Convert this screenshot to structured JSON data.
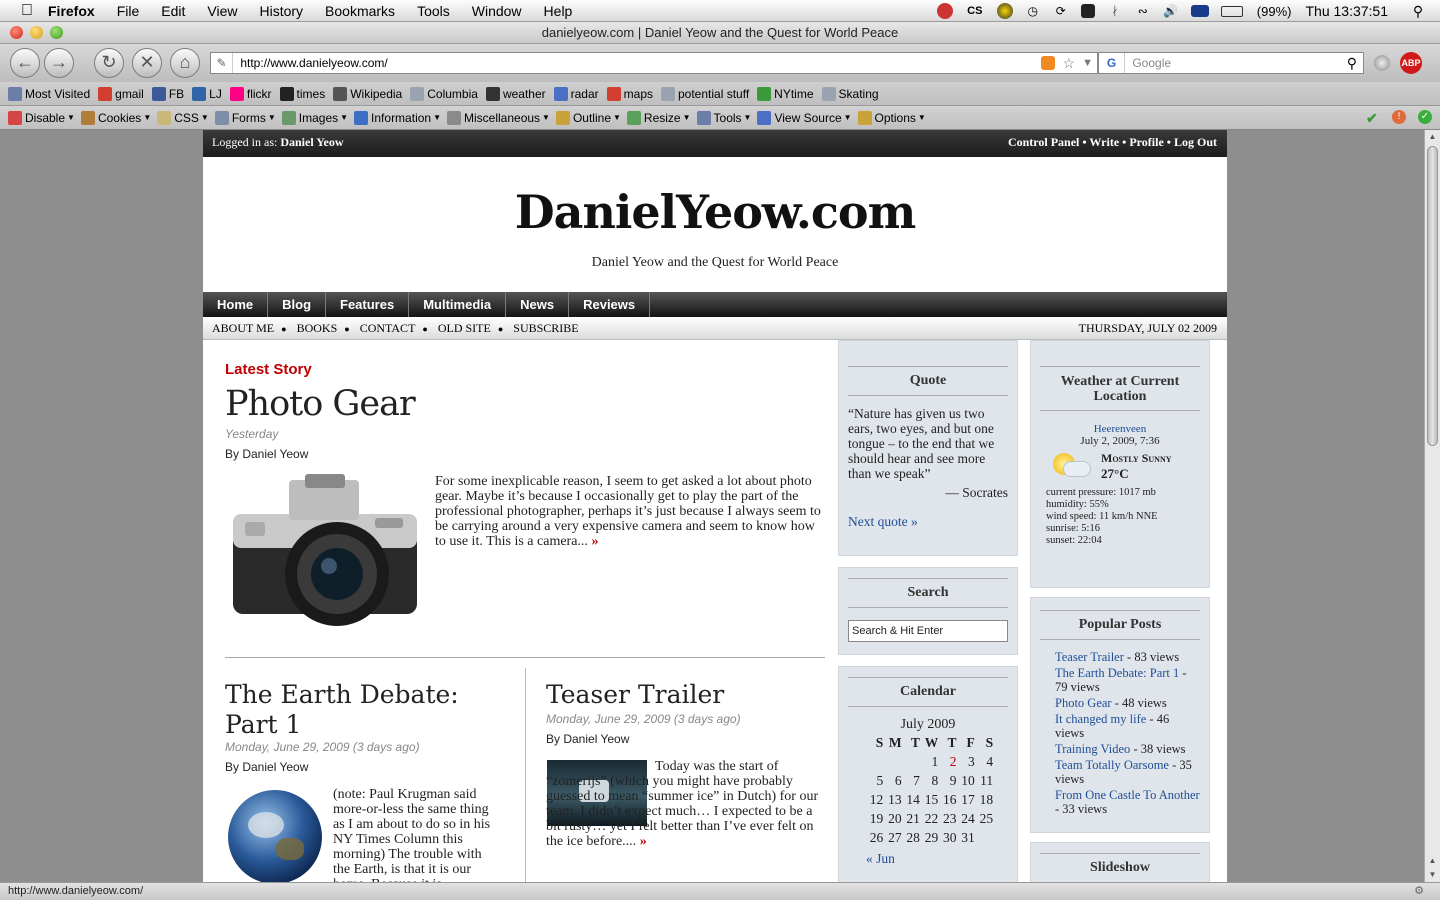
{
  "menubar": {
    "app": "Firefox",
    "items": [
      "File",
      "Edit",
      "View",
      "History",
      "Bookmarks",
      "Tools",
      "Window",
      "Help"
    ],
    "battery": "(99%)",
    "clock": "Thu 13:37:51"
  },
  "window": {
    "title": "danielyeow.com | Daniel Yeow and the Quest for World Peace"
  },
  "navbar": {
    "url": "http://www.danielyeow.com/",
    "search_placeholder": "Google"
  },
  "bookmarks": [
    {
      "label": "Most Visited",
      "icon": "bookmark-icon",
      "color": "#6a7ea8"
    },
    {
      "label": "gmail",
      "icon": "google-icon",
      "color": "#d23f31"
    },
    {
      "label": "FB",
      "icon": "facebook-icon",
      "color": "#3b5998"
    },
    {
      "label": "LJ",
      "icon": "livejournal-icon",
      "color": "#3066a8"
    },
    {
      "label": "flickr",
      "icon": "flickr-icon",
      "color": "#ff0084"
    },
    {
      "label": "times",
      "icon": "times-icon",
      "color": "#222222"
    },
    {
      "label": "Wikipedia",
      "icon": "wikipedia-icon",
      "color": "#555555"
    },
    {
      "label": "Columbia",
      "icon": "folder-icon",
      "color": "#9aa4b0"
    },
    {
      "label": "weather",
      "icon": "bbc-icon",
      "color": "#333333"
    },
    {
      "label": "radar",
      "icon": "radar-icon",
      "color": "#4a6fc4"
    },
    {
      "label": "maps",
      "icon": "google-icon",
      "color": "#d23f31"
    },
    {
      "label": "potential stuff",
      "icon": "folder-icon",
      "color": "#9aa4b0"
    },
    {
      "label": "NYtime",
      "icon": "nytimes-icon",
      "color": "#3a9a3a"
    },
    {
      "label": "Skating",
      "icon": "folder-icon",
      "color": "#9aa4b0"
    }
  ],
  "webdev": [
    {
      "label": "Disable",
      "icon": "disable-icon",
      "color": "#d64545"
    },
    {
      "label": "Cookies",
      "icon": "cookie-icon",
      "color": "#b07d3a"
    },
    {
      "label": "CSS",
      "icon": "css-icon",
      "color": "#c9b878"
    },
    {
      "label": "Forms",
      "icon": "forms-icon",
      "color": "#7d8fa8"
    },
    {
      "label": "Images",
      "icon": "images-icon",
      "color": "#6a9a6a"
    },
    {
      "label": "Information",
      "icon": "info-icon",
      "color": "#3a6fc4"
    },
    {
      "label": "Miscellaneous",
      "icon": "misc-icon",
      "color": "#8a8a8a"
    },
    {
      "label": "Outline",
      "icon": "outline-icon",
      "color": "#c9a23a"
    },
    {
      "label": "Resize",
      "icon": "resize-icon",
      "color": "#5aa05a"
    },
    {
      "label": "Tools",
      "icon": "tools-icon",
      "color": "#6a7ea8"
    },
    {
      "label": "View Source",
      "icon": "source-icon",
      "color": "#4a6fc4"
    },
    {
      "label": "Options",
      "icon": "options-icon",
      "color": "#c9a23a"
    }
  ],
  "site": {
    "logged_in_prefix": "Logged in as:",
    "user": "Daniel Yeow",
    "admin_links": [
      "Control Panel",
      "Write",
      "Profile",
      "Log Out"
    ],
    "logo": "DanielYeow.com",
    "tagline": "Daniel Yeow and the Quest for World Peace",
    "tabs": [
      "Home",
      "Blog",
      "Features",
      "Multimedia",
      "News",
      "Reviews"
    ],
    "subnav": [
      "About Me",
      "Books",
      "Contact",
      "Old Site",
      "Subscribe"
    ],
    "date": "THURSDAY, JULY 02 2009"
  },
  "latest": {
    "label": "Latest Story",
    "title": "Photo Gear",
    "when": "Yesterday",
    "by": "By Daniel Yeow",
    "excerpt": "For some inexplicable reason, I seem to get asked a lot about photo gear. Maybe it’s because I occasionally get to play the part of the professional photographer, perhaps it’s just because I always seem to be carrying around a very expensive camera and seem to know how to use it. This is a camera...",
    "more": "»"
  },
  "story2": {
    "title": "The Earth Debate: Part 1",
    "when": "Monday, June 29, 2009 (3 days ago)",
    "by": "By Daniel Yeow",
    "excerpt": "(note: Paul Krugman said more-or-less the same thing as I am about to do so in his NY Times Column this morning) The trouble with the Earth, is that it is our home. Because it is"
  },
  "story3": {
    "title": "Teaser Trailer",
    "when": "Monday, June 29, 2009 (3 days ago)",
    "by": "By Daniel Yeow",
    "excerpt": "Today was the start of “zomerijs” (which you might have probably guessed to mean “summer ice” in Dutch) for our team. I didn’t expect much… I expected to be a bit rusty… yet I felt better than I’ve ever felt on the ice before....",
    "more": "»"
  },
  "quote": {
    "heading": "Quote",
    "text": "“Nature has given us two ears, two eyes, and but one tongue – to the end that we should hear and see more than we speak”",
    "author": "— Socrates",
    "next": "Next quote »"
  },
  "search": {
    "heading": "Search",
    "placeholder": "Search & Hit Enter"
  },
  "calendar": {
    "heading": "Calendar",
    "month": "July 2009",
    "days": [
      "S",
      "M",
      "T",
      "W",
      "T",
      "F",
      "S"
    ],
    "weeks": [
      [
        "",
        "",
        "",
        "1",
        "2",
        "3",
        "4"
      ],
      [
        "5",
        "6",
        "7",
        "8",
        "9",
        "10",
        "11"
      ],
      [
        "12",
        "13",
        "14",
        "15",
        "16",
        "17",
        "18"
      ],
      [
        "19",
        "20",
        "21",
        "22",
        "23",
        "24",
        "25"
      ],
      [
        "26",
        "27",
        "28",
        "29",
        "30",
        "31",
        ""
      ]
    ],
    "today": "2",
    "prev": "« Jun"
  },
  "weather": {
    "heading": "Weather at Current Location",
    "city": "Heerenveen",
    "time": "July 2, 2009, 7:36",
    "condition": "Mostly Sunny",
    "temp": "27°C",
    "pressure": "current pressure: 1017 mb",
    "humidity": "humidity: 55%",
    "wind": "wind speed: 11 km/h NNE",
    "sunrise": "sunrise: 5:16",
    "sunset": "sunset: 22:04"
  },
  "popular": {
    "heading": "Popular Posts",
    "items": [
      {
        "title": "Teaser Trailer",
        "views": " - 83 views"
      },
      {
        "title": "The Earth Debate: Part 1",
        "views": " - 79 views"
      },
      {
        "title": "Photo Gear",
        "views": " - 48 views"
      },
      {
        "title": "It changed my life",
        "views": " - 46 views"
      },
      {
        "title": "Training Video",
        "views": " - 38 views"
      },
      {
        "title": "Team Totally Oarsome",
        "views": " - 35 views"
      },
      {
        "title": "From One Castle To Another",
        "views": " - 33 views"
      }
    ]
  },
  "slideshow": {
    "heading": "Slideshow"
  },
  "status": {
    "text": "http://www.danielyeow.com/"
  }
}
